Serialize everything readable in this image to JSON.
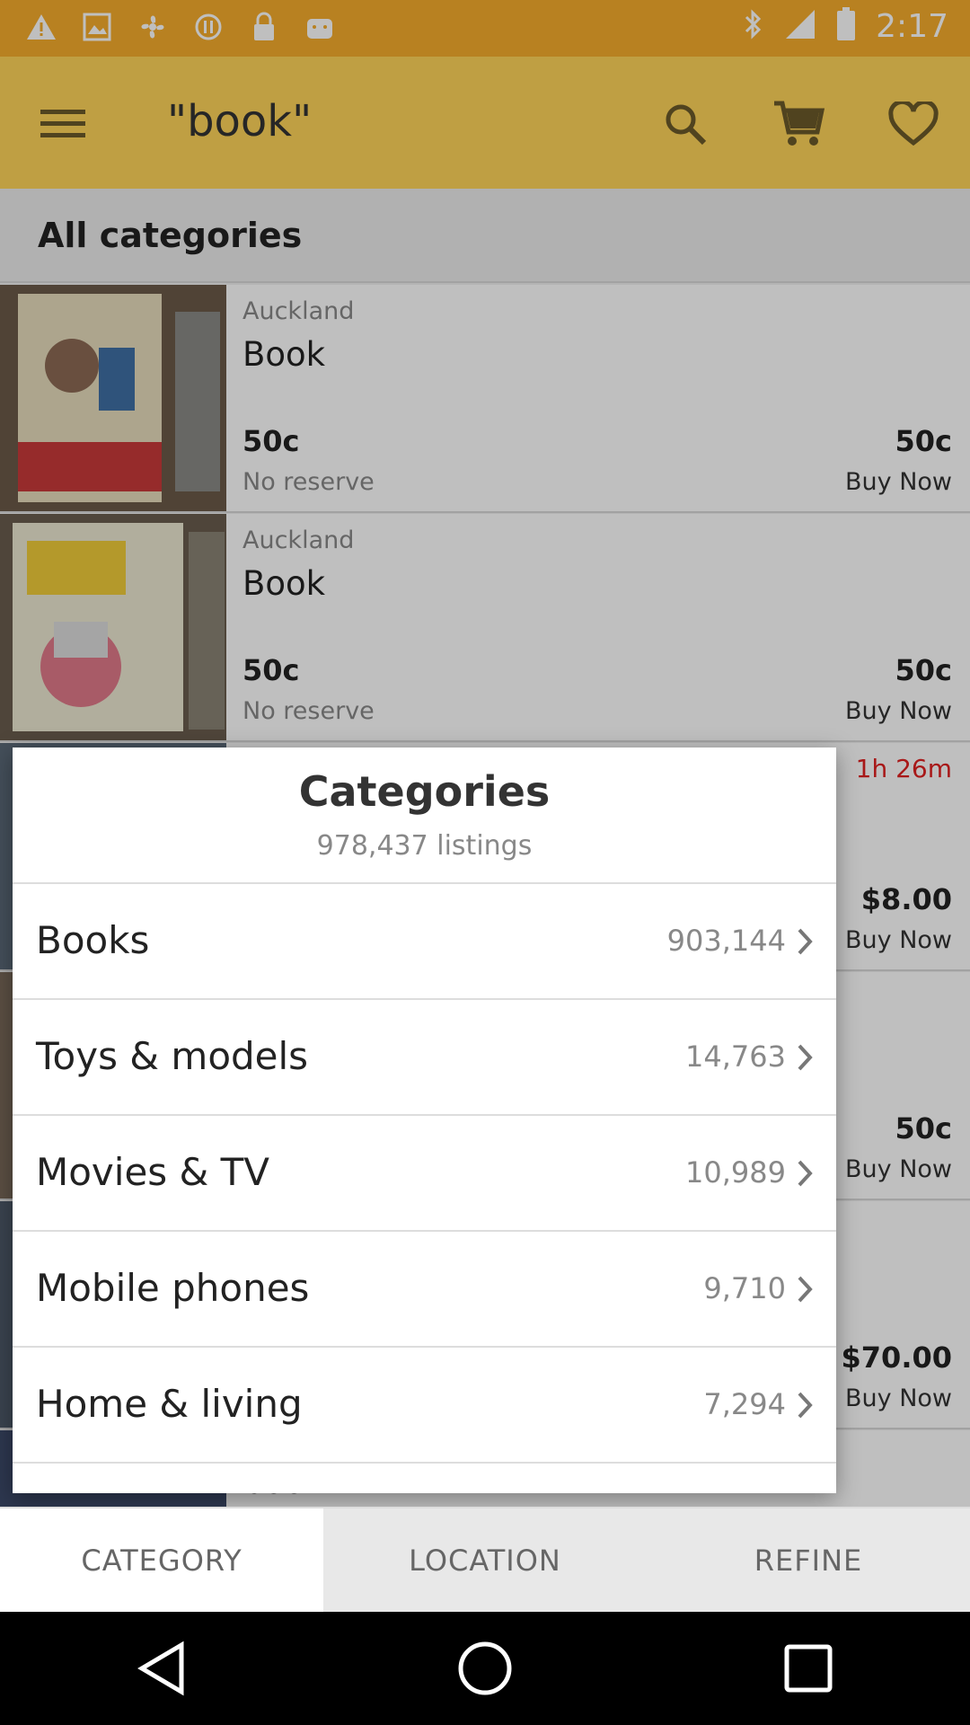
{
  "status_bar": {
    "time": "2:17",
    "icons": [
      "warning-icon",
      "image-icon",
      "fan-icon",
      "sync-icon",
      "lock-icon",
      "android-icon",
      "bluetooth-icon",
      "signal-icon",
      "battery-icon"
    ]
  },
  "app_bar": {
    "title": "\"book\"",
    "icons": [
      "menu-icon",
      "search-icon",
      "cart-icon",
      "heart-icon"
    ]
  },
  "section_header": "All categories",
  "listings": [
    {
      "location": "Auckland",
      "name": "Book",
      "price_left": "50c",
      "price_right": "50c",
      "reserve": "No reserve",
      "buy_label": "Buy Now"
    },
    {
      "location": "Auckland",
      "name": "Book",
      "price_left": "50c",
      "price_right": "50c",
      "reserve": "No reserve",
      "buy_label": "Buy Now"
    },
    {
      "timer": "1h 26m",
      "price_right": "$8.00",
      "buy_label": "Buy Now"
    },
    {
      "price_right": "50c",
      "buy_label": "Buy Now"
    },
    {
      "price_right": "$70.00",
      "buy_label": "Buy Now"
    },
    {
      "name_partial": "book"
    }
  ],
  "dialog": {
    "title": "Categories",
    "subtitle": "978,437 listings",
    "categories": [
      {
        "label": "Books",
        "count": "903,144"
      },
      {
        "label": "Toys & models",
        "count": "14,763"
      },
      {
        "label": "Movies & TV",
        "count": "10,989"
      },
      {
        "label": "Mobile phones",
        "count": "9,710"
      },
      {
        "label": "Home & living",
        "count": "7,294"
      }
    ]
  },
  "tabs": [
    "CATEGORY",
    "LOCATION",
    "REFINE"
  ],
  "nav": [
    "back-icon",
    "home-icon",
    "recents-icon"
  ],
  "colors": {
    "status_bar": "#f6ad2d",
    "app_bar": "#ffd45a",
    "timer": "#e02020"
  }
}
